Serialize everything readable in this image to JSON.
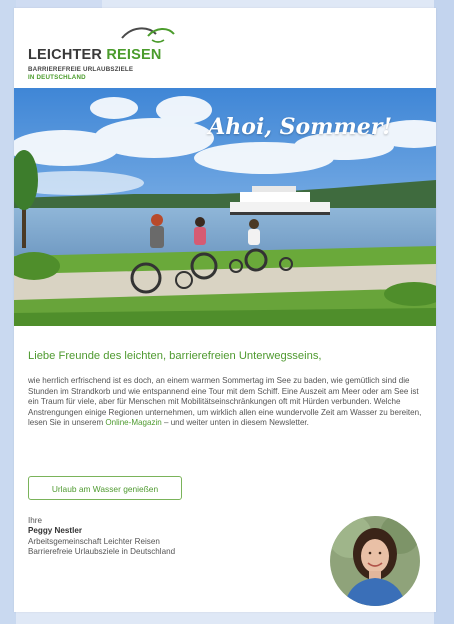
{
  "logo": {
    "title_part1": "LEICHTER",
    "title_part2": "REISEN",
    "subtitle_line1": "BARRIEREFREIE URLAUBSZIELE",
    "subtitle_line2": "IN DEUTSCHLAND"
  },
  "hero": {
    "overlay_text": "Ahoi, Sommer!"
  },
  "content": {
    "greeting": "Liebe Freunde des leichten, barrierefreien Unterwegsseins,",
    "paragraph_before_link": "wie herrlich erfrischend ist es doch, an einem warmen Sommertag im See zu baden, wie gemütlich sind die Stunden im Strandkorb und wie entspannend eine Tour mit dem Schiff. Eine Auszeit am Meer oder am See ist ein Traum für viele, aber für Menschen mit Mobilitätseinschränkungen oft mit Hürden verbunden. Welche Anstrengungen einige Regionen unternehmen, um wirklich allen eine wundervolle Zeit am Wasser zu bereiten, lesen Sie in unserem ",
    "link_text": "Online-Magazin",
    "paragraph_after_link": " – und weiter unten in diesem Newsletter.",
    "cta_label": "Urlaub am Wasser genießen"
  },
  "signature": {
    "salutation": "Ihre",
    "name": "Peggy Nestler",
    "line1": "Arbeitsgemeinschaft Leichter Reisen",
    "line2": "Barrierefreie Urlaubsziele in Deutschland"
  },
  "colors": {
    "accent_green": "#4f9a30",
    "background": "#dfe8f6"
  }
}
